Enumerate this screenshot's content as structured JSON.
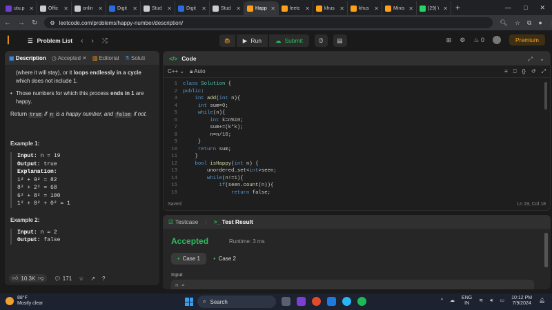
{
  "browser": {
    "tabs": [
      {
        "label": "utu.p",
        "color": "#6a3fd1",
        "active": false
      },
      {
        "label": "Offic",
        "color": "#cccccc",
        "active": false
      },
      {
        "label": "onlin",
        "color": "#cccccc",
        "active": false
      },
      {
        "label": "Digit",
        "color": "#2b6be0",
        "active": false
      },
      {
        "label": "Stud",
        "color": "#cccccc",
        "active": false
      },
      {
        "label": "Digit",
        "color": "#2b6be0",
        "active": false
      },
      {
        "label": "Stud",
        "color": "#cccccc",
        "active": false
      },
      {
        "label": "Happ",
        "color": "#ffa116",
        "active": true
      },
      {
        "label": "leetc",
        "color": "#ffa116",
        "active": false
      },
      {
        "label": "khus",
        "color": "#ffa116",
        "active": false
      },
      {
        "label": "khus",
        "color": "#ffa116",
        "active": false
      },
      {
        "label": "Minis",
        "color": "#ffa116",
        "active": false
      },
      {
        "label": "(29) \\",
        "color": "#25d366",
        "active": false
      }
    ],
    "url": "leetcode.com/problems/happy-number/description/"
  },
  "header": {
    "problem_list": "Problem List",
    "run": "Run",
    "submit": "Submit",
    "streak": "0",
    "premium": "Premium"
  },
  "left": {
    "tabs": [
      "Description",
      "Accepted",
      "Editorial",
      "Soluti"
    ],
    "bullet1_a": "(where it will stay), or it ",
    "bullet1_b": "loops endlessly in a cycle",
    "bullet1_c": " which does not include 1.",
    "bullet2_a": "Those numbers for which this process ",
    "bullet2_b": "ends in 1",
    "bullet2_c": " are happy.",
    "ret_a": "Return ",
    "ret_true": "true",
    "ret_b": " if ",
    "ret_n": "n",
    "ret_c": " is a happy number, and ",
    "ret_false": "false",
    "ret_d": " if not.",
    "ex1_title": "Example 1:",
    "ex1_input_lbl": "Input:",
    "ex1_input": " n = 19",
    "ex1_output_lbl": "Output:",
    "ex1_output": " true",
    "ex1_expl_lbl": "Explanation:",
    "ex1_lines": [
      "1² + 9² = 82",
      "8² + 2² = 68",
      "6² + 8² = 100",
      "1² + 0² + 0² = 1"
    ],
    "ex2_title": "Example 2:",
    "ex2_input_lbl": "Input:",
    "ex2_input": " n = 2",
    "ex2_output_lbl": "Output:",
    "ex2_output": " false",
    "likes": "10.3K",
    "comments": "171"
  },
  "code": {
    "title": "Code",
    "language": "C++",
    "mode": "Auto",
    "saved": "Saved",
    "cursor": "Ln 19, Col 18",
    "lines": [
      "class Solution {",
      "public:",
      "    int add(int n){",
      "     int sum=0;",
      "     while(n){",
      "         int k=n%10;",
      "         sum+=(k*k);",
      "         n=n/10;",
      "     }",
      "     return sum;",
      "    }",
      "    bool isHappy(int n) {",
      "        unordered_set<int>seen;",
      "        while(n!=1){",
      "            if(seen.count(n)){",
      "                return false;"
    ]
  },
  "result": {
    "tab1": "Testcase",
    "tab2": "Test Result",
    "status": "Accepted",
    "runtime": "Runtime: 3 ms",
    "case1": "Case 1",
    "case2": "Case 2",
    "input_label": "Input",
    "input_value": "n ="
  },
  "taskbar": {
    "temp": "88°F",
    "weather": "Mostly clear",
    "search": "Search",
    "lang1": "ENG",
    "lang2": "IN",
    "time": "10:12 PM",
    "date": "7/9/2024"
  }
}
